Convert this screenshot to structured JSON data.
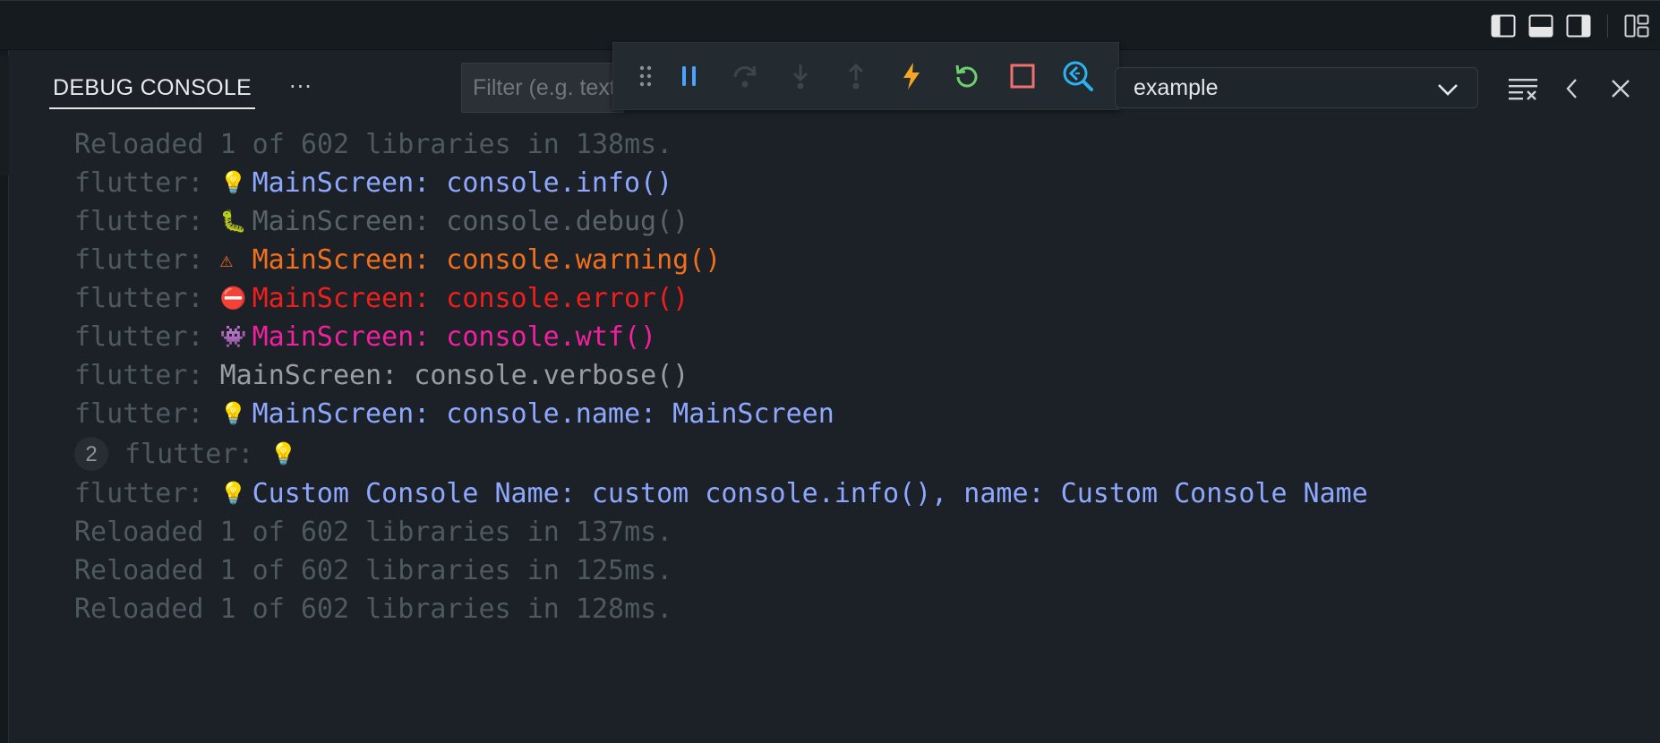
{
  "panel": {
    "tab_label": "DEBUG CONSOLE",
    "more_label": "···",
    "filter_placeholder": "Filter (e.g. text, !exclude)",
    "session_select": "example"
  },
  "toolbar": {
    "buttons": [
      {
        "name": "drag-grip",
        "icon": "grip-icon"
      },
      {
        "name": "pause-button",
        "icon": "pause-icon",
        "color": "#4aa3ff"
      },
      {
        "name": "step-over-button",
        "icon": "step-over-icon",
        "disabled": true
      },
      {
        "name": "step-into-button",
        "icon": "step-into-icon",
        "disabled": true
      },
      {
        "name": "step-out-button",
        "icon": "step-out-icon",
        "disabled": true
      },
      {
        "name": "hot-reload-button",
        "icon": "lightning-icon",
        "color": "#f5a623"
      },
      {
        "name": "restart-button",
        "icon": "restart-icon",
        "color": "#6fcf6f"
      },
      {
        "name": "stop-button",
        "icon": "stop-icon",
        "color": "#f07070"
      },
      {
        "name": "flutter-inspector-button",
        "icon": "flutter-inspector-icon",
        "color": "#2bb3f0"
      }
    ]
  },
  "console": {
    "lines": [
      {
        "prefix": "",
        "emoji": "",
        "text": "Reloaded 1 of 602 libraries in 138ms.",
        "kind": "dim"
      },
      {
        "prefix": "flutter: ",
        "emoji": "💡",
        "text": "MainScreen: console.info()",
        "kind": "info"
      },
      {
        "prefix": "flutter: ",
        "emoji": "🐛",
        "text": "MainScreen: console.debug()",
        "kind": "debug"
      },
      {
        "prefix": "flutter: ",
        "emoji": "⚠",
        "text": "MainScreen: console.warning()",
        "kind": "warn"
      },
      {
        "prefix": "flutter: ",
        "emoji": "⛔",
        "text": "MainScreen: console.error()",
        "kind": "err"
      },
      {
        "prefix": "flutter: ",
        "emoji": "👾",
        "text": "MainScreen: console.wtf()",
        "kind": "wtf"
      },
      {
        "prefix": "flutter: ",
        "emoji": "",
        "text": "MainScreen: console.verbose()",
        "kind": "verbose"
      },
      {
        "prefix": "flutter: ",
        "emoji": "💡",
        "text": "MainScreen: console.name: MainScreen",
        "kind": "info"
      },
      {
        "prefix": "flutter: ",
        "emoji": "💡",
        "text": "",
        "kind": "info",
        "count": "2"
      },
      {
        "prefix": "flutter: ",
        "emoji": "💡",
        "text": "Custom Console Name: custom console.info(), name: Custom Console Name",
        "kind": "info"
      },
      {
        "prefix": "",
        "emoji": "",
        "text": "Reloaded 1 of 602 libraries in 137ms.",
        "kind": "dim"
      },
      {
        "prefix": "",
        "emoji": "",
        "text": "Reloaded 1 of 602 libraries in 125ms.",
        "kind": "dim"
      },
      {
        "prefix": "",
        "emoji": "",
        "text": "Reloaded 1 of 602 libraries in 128ms.",
        "kind": "dim"
      }
    ]
  }
}
